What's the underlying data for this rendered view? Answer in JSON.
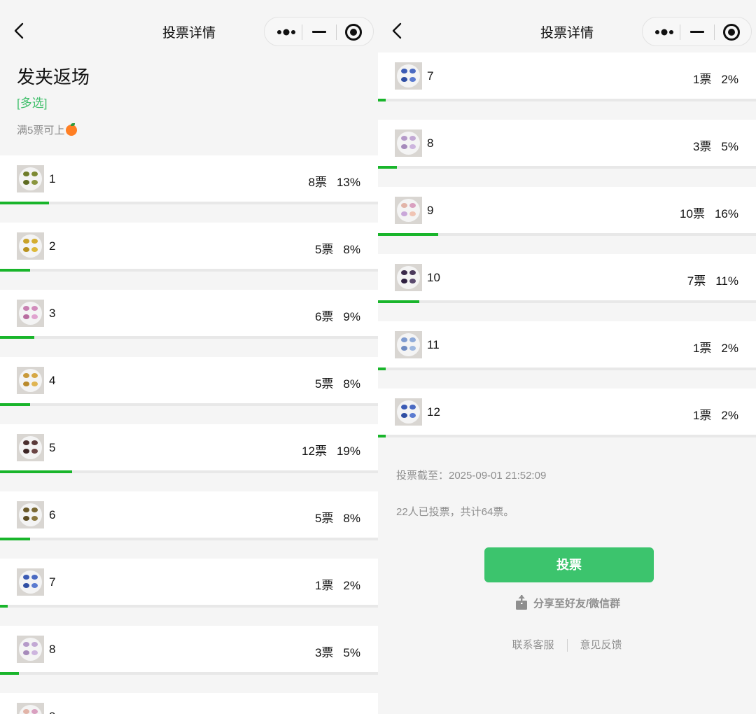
{
  "nav": {
    "title": "投票详情"
  },
  "poll": {
    "title": "发夹返场",
    "type_label": "[多选]",
    "note": "满5票可上"
  },
  "options": [
    {
      "label": "1",
      "votes": "8票",
      "percent": "13%",
      "share": 0.13,
      "colors": [
        "#6f7d2a",
        "#7d8a33",
        "#5e6b22",
        "#8a9640"
      ]
    },
    {
      "label": "2",
      "votes": "5票",
      "percent": "8%",
      "share": 0.08,
      "colors": [
        "#c9a227",
        "#d4ad30",
        "#b8921e",
        "#ddb93a"
      ]
    },
    {
      "label": "3",
      "votes": "6票",
      "percent": "9%",
      "share": 0.09,
      "colors": [
        "#c77fb0",
        "#d28cbc",
        "#b86da0",
        "#e0a3cf"
      ]
    },
    {
      "label": "4",
      "votes": "5票",
      "percent": "8%",
      "share": 0.08,
      "colors": [
        "#c99a3a",
        "#d6a845",
        "#b98a2c",
        "#e0b552"
      ]
    },
    {
      "label": "5",
      "votes": "12票",
      "percent": "19%",
      "share": 0.19,
      "colors": [
        "#4a2f2f",
        "#5a3a3a",
        "#3d2626",
        "#6b4545"
      ]
    },
    {
      "label": "6",
      "votes": "5票",
      "percent": "8%",
      "share": 0.08,
      "colors": [
        "#6b5a2a",
        "#7a6833",
        "#5c4c22",
        "#8a773e"
      ]
    },
    {
      "label": "7",
      "votes": "1票",
      "percent": "2%",
      "share": 0.02,
      "colors": [
        "#3b5bb5",
        "#4a6ac2",
        "#2f4ea3",
        "#5b7bd0"
      ]
    },
    {
      "label": "8",
      "votes": "3票",
      "percent": "5%",
      "share": 0.05,
      "colors": [
        "#b59ac9",
        "#c2a8d4",
        "#a68bbb",
        "#cdb5de"
      ]
    },
    {
      "label": "9",
      "votes": "10票",
      "percent": "16%",
      "share": 0.16,
      "colors": [
        "#e2b4a8",
        "#d9a0c0",
        "#c9a7d9",
        "#f0c4b4"
      ]
    },
    {
      "label": "10",
      "votes": "7票",
      "percent": "11%",
      "share": 0.11,
      "colors": [
        "#3a2a4a",
        "#4b3a5c",
        "#2e2040",
        "#5a4a6e"
      ]
    },
    {
      "label": "11",
      "votes": "1票",
      "percent": "2%",
      "share": 0.02,
      "colors": [
        "#7f9bd0",
        "#8eaad9",
        "#6f8bc2",
        "#9eb8e0"
      ]
    },
    {
      "label": "12",
      "votes": "1票",
      "percent": "2%",
      "share": 0.02,
      "colors": [
        "#3b5bb5",
        "#4a6ac2",
        "#2f4ea3",
        "#5b7bd0"
      ]
    }
  ],
  "footer": {
    "deadline": "投票截至：2025-09-01 21:52:09",
    "summary": "22人已投票，共计64票。",
    "vote_button": "投票",
    "share_label": "分享至好友/微信群",
    "contact_label": "联系客服",
    "feedback_label": "意见反馈"
  }
}
